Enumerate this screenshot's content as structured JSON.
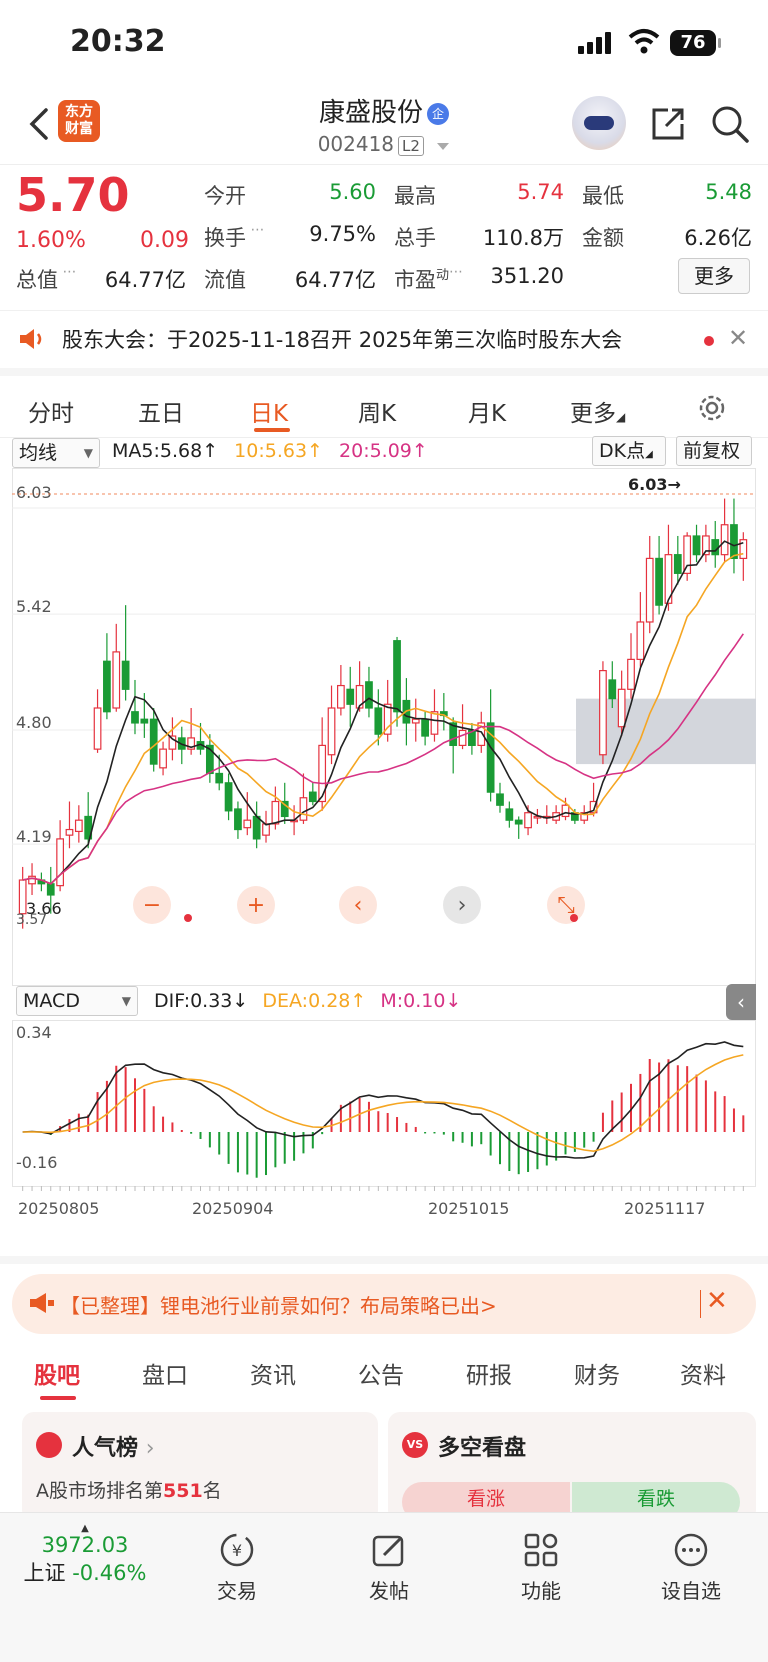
{
  "status_bar": {
    "time": "20:32",
    "battery": "76"
  },
  "header": {
    "name": "康盛股份",
    "name_badge": "企",
    "code": "002418",
    "level": "L2",
    "logo_line1": "东方",
    "logo_line2": "财富"
  },
  "quote": {
    "price": "5.70",
    "change_pct": "1.60%",
    "change": "0.09",
    "open_label": "今开",
    "open": "5.60",
    "high_label": "最高",
    "high": "5.74",
    "low_label": "最低",
    "low": "5.48",
    "turnover_label": "换手",
    "turnover": "9.75%",
    "volume_label": "总手",
    "volume": "110.8万",
    "amount_label": "金额",
    "amount": "6.26亿",
    "mktcap_label": "总值",
    "mktcap": "64.77亿",
    "float_label": "流值",
    "float_cap": "64.77亿",
    "pe_label": "市盈",
    "pe_sup": "动",
    "pe": "351.20",
    "more": "更多"
  },
  "notice": {
    "text": "股东大会：于2025-11-18召开 2025年第三次临时股东大会"
  },
  "chart_tabs": [
    "分时",
    "五日",
    "日K",
    "周K",
    "月K",
    "更多"
  ],
  "chart_controls": {
    "ma_select": "均线",
    "ma5": "MA5:5.68",
    "ma10": "10:5.63",
    "ma20": "20:5.09",
    "dk": "DK点",
    "adjust": "前复权",
    "macd_select": "MACD",
    "dif": "DIF:0.33",
    "dea": "DEA:0.28",
    "m": "M:0.10"
  },
  "colors": {
    "up": "#e5323e",
    "down": "#1a9b35",
    "ma5": "#222222",
    "ma10": "#f5a623",
    "ma20": "#d63384",
    "accent": "#e85a23"
  },
  "chart_data": [
    {
      "type": "candlestick",
      "ylim": [
        3.57,
        6.03
      ],
      "y_ticks": [
        "6.03",
        "5.42",
        "4.80",
        "4.19"
      ],
      "high_mark": "6.03→",
      "low_mark": "3.66",
      "low_axis": "3.57",
      "x_ticks": [
        "20250805",
        "20250904",
        "20251015",
        "20251117"
      ],
      "candles": [
        [
          3.7,
          3.88,
          3.95,
          3.62
        ],
        [
          3.86,
          3.9,
          3.97,
          3.8
        ],
        [
          3.88,
          3.86,
          3.92,
          3.82
        ],
        [
          3.86,
          3.8,
          3.95,
          3.7
        ],
        [
          3.85,
          4.1,
          4.2,
          3.82
        ],
        [
          4.12,
          4.15,
          4.3,
          4.05
        ],
        [
          4.14,
          4.2,
          4.28,
          4.08
        ],
        [
          4.22,
          4.1,
          4.35,
          4.05
        ],
        [
          4.58,
          4.8,
          4.9,
          4.56
        ],
        [
          5.05,
          4.78,
          5.2,
          4.74
        ],
        [
          4.8,
          5.1,
          5.25,
          4.78
        ],
        [
          5.05,
          4.9,
          5.35,
          4.84
        ],
        [
          4.78,
          4.72,
          4.95,
          4.66
        ],
        [
          4.74,
          4.72,
          4.88,
          4.64
        ],
        [
          4.74,
          4.5,
          4.8,
          4.46
        ],
        [
          4.48,
          4.58,
          4.62,
          4.44
        ],
        [
          4.58,
          4.65,
          4.75,
          4.52
        ],
        [
          4.64,
          4.58,
          4.7,
          4.5
        ],
        [
          4.58,
          4.64,
          4.8,
          4.55
        ],
        [
          4.62,
          4.58,
          4.72,
          4.55
        ],
        [
          4.6,
          4.45,
          4.66,
          4.4
        ],
        [
          4.45,
          4.4,
          4.55,
          4.36
        ],
        [
          4.4,
          4.25,
          4.45,
          4.2
        ],
        [
          4.26,
          4.15,
          4.3,
          4.1
        ],
        [
          4.16,
          4.2,
          4.35,
          4.12
        ],
        [
          4.22,
          4.1,
          4.3,
          4.05
        ],
        [
          4.12,
          4.18,
          4.25,
          4.08
        ],
        [
          4.18,
          4.3,
          4.38,
          4.15
        ],
        [
          4.3,
          4.22,
          4.4,
          4.18
        ],
        [
          4.2,
          4.2,
          4.28,
          4.12
        ],
        [
          4.2,
          4.32,
          4.45,
          4.18
        ],
        [
          4.35,
          4.3,
          4.4,
          4.28
        ],
        [
          4.3,
          4.6,
          4.75,
          4.25
        ],
        [
          4.55,
          4.8,
          4.92,
          4.5
        ],
        [
          4.8,
          4.92,
          5.03,
          4.76
        ],
        [
          4.9,
          4.82,
          5.02,
          4.7
        ],
        [
          4.8,
          4.92,
          5.05,
          4.78
        ],
        [
          4.94,
          4.8,
          5.02,
          4.75
        ],
        [
          4.8,
          4.66,
          4.9,
          4.6
        ],
        [
          4.66,
          4.82,
          4.95,
          4.62
        ],
        [
          5.16,
          4.78,
          5.18,
          4.7
        ],
        [
          4.84,
          4.72,
          4.96,
          4.6
        ],
        [
          4.72,
          4.74,
          4.85,
          4.62
        ],
        [
          4.74,
          4.65,
          4.78,
          4.6
        ],
        [
          4.66,
          4.78,
          4.9,
          4.62
        ],
        [
          4.78,
          4.76,
          4.88,
          4.68
        ],
        [
          4.72,
          4.6,
          4.75,
          4.45
        ],
        [
          4.6,
          4.68,
          4.82,
          4.58
        ],
        [
          4.68,
          4.6,
          4.72,
          4.55
        ],
        [
          4.6,
          4.72,
          4.78,
          4.56
        ],
        [
          4.72,
          4.35,
          4.9,
          4.3
        ],
        [
          4.34,
          4.28,
          4.4,
          4.24
        ],
        [
          4.26,
          4.2,
          4.3,
          4.16
        ],
        [
          4.2,
          4.18,
          4.22,
          4.1
        ],
        [
          4.16,
          4.24,
          4.28,
          4.12
        ],
        [
          4.22,
          4.22,
          4.26,
          4.18
        ],
        [
          4.22,
          4.22,
          4.28,
          4.18
        ],
        [
          4.2,
          4.24,
          4.28,
          4.18
        ],
        [
          4.22,
          4.28,
          4.32,
          4.2
        ],
        [
          4.24,
          4.2,
          4.26,
          4.18
        ],
        [
          4.2,
          4.24,
          4.28,
          4.18
        ],
        [
          4.24,
          4.3,
          4.4,
          4.22
        ],
        [
          4.55,
          5.0,
          5.05,
          4.5
        ],
        [
          4.95,
          4.85,
          5.05,
          4.8
        ],
        [
          4.7,
          4.9,
          5.0,
          4.65
        ],
        [
          4.9,
          5.06,
          5.2,
          4.85
        ],
        [
          5.06,
          5.26,
          5.42,
          5.02
        ],
        [
          5.26,
          5.6,
          5.72,
          5.2
        ],
        [
          5.6,
          5.35,
          5.72,
          5.3
        ],
        [
          5.36,
          5.62,
          5.78,
          5.32
        ],
        [
          5.62,
          5.52,
          5.72,
          5.46
        ],
        [
          5.52,
          5.72,
          5.74,
          5.48
        ],
        [
          5.72,
          5.62,
          5.78,
          5.58
        ],
        [
          5.62,
          5.72,
          5.78,
          5.58
        ],
        [
          5.7,
          5.62,
          5.8,
          5.55
        ],
        [
          5.62,
          5.78,
          5.92,
          5.58
        ],
        [
          5.78,
          5.6,
          5.92,
          5.52
        ],
        [
          5.6,
          5.7,
          5.74,
          5.48
        ]
      ],
      "zone": {
        "y_top": 4.85,
        "y_bottom": 4.5
      }
    },
    {
      "type": "macd",
      "ylim": [
        -0.16,
        0.34
      ],
      "y_ticks": [
        "0.34",
        "-0.16"
      ]
    }
  ],
  "chart_buttons": [
    "zoom-out",
    "zoom-in",
    "prev",
    "next",
    "expand"
  ],
  "ad": {
    "text": "【已整理】锂电池行业前景如何？布局策略已出>"
  },
  "bottom_tabs": [
    "股吧",
    "盘口",
    "资讯",
    "公告",
    "研报",
    "财务",
    "资料"
  ],
  "cards": {
    "popularity_title": "人气榜",
    "popularity_desc_prefix": "A股市场排名第",
    "popularity_rank": "551",
    "popularity_desc_suffix": "名",
    "sentiment_title": "多空看盘",
    "bull": "看涨",
    "bear": "看跌"
  },
  "footer": {
    "index_value": "3972.03",
    "index_name": "上证",
    "index_change": "-0.46%",
    "items": [
      "交易",
      "发帖",
      "功能",
      "设自选"
    ]
  }
}
